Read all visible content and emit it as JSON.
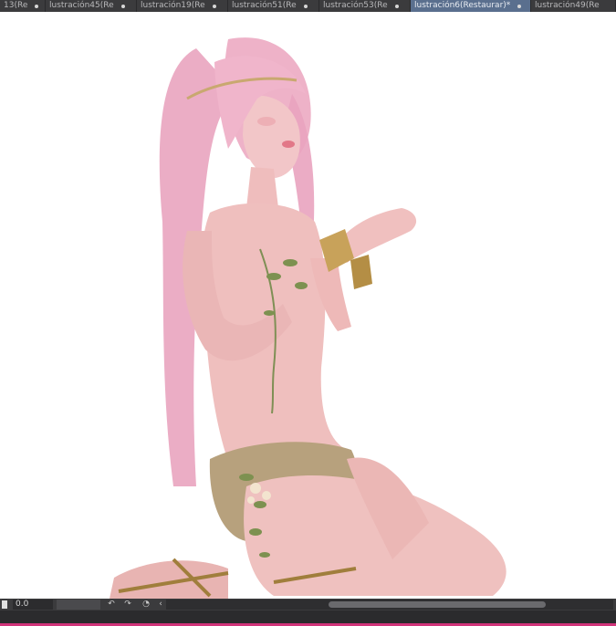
{
  "tabs": [
    {
      "label": "13(Re"
    },
    {
      "label": "lustración45(Re"
    },
    {
      "label": "lustración19(Re"
    },
    {
      "label": "lustración51(Re"
    },
    {
      "label": "lustración53(Re"
    },
    {
      "label": "lustración6(Restaurar)*",
      "active": true
    },
    {
      "label": "lustración49(Re"
    }
  ],
  "status": {
    "zoom_value": "0.0",
    "rotate_left_icon": "rotate-ccw-icon",
    "rotate_right_icon": "rotate-cw-icon",
    "reset_icon": "reset-rotation-icon",
    "arrow_icon": "chevron-left-icon"
  },
  "colors": {
    "accent": "#d1347a",
    "tab_active": "#5a6f8e",
    "chrome": "#3b3b3d"
  }
}
